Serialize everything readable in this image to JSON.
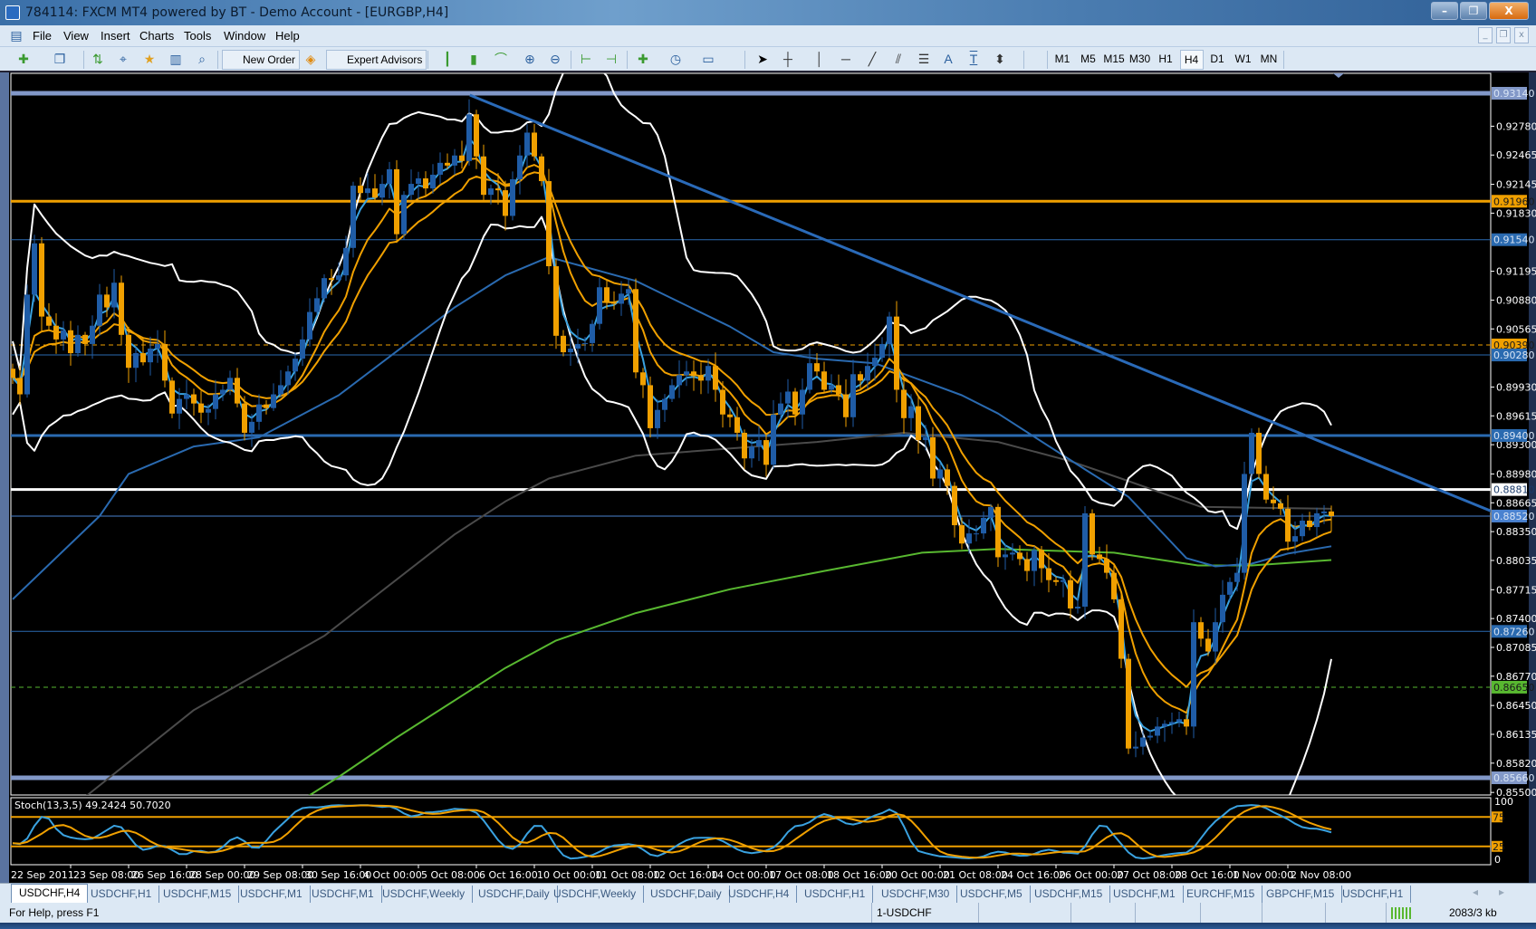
{
  "window": {
    "title": "784114: FXCM MT4 powered by BT - Demo Account - [EURGBP,H4]",
    "min": "–",
    "restore": "❐",
    "close": "X"
  },
  "menu": [
    "File",
    "View",
    "Insert",
    "Charts",
    "Tools",
    "Window",
    "Help"
  ],
  "mdi": {
    "min": "_",
    "restore": "❐",
    "close": "x"
  },
  "toolbar": {
    "new_order": "New Order",
    "expert_advisors": "Expert Advisors",
    "timeframes": [
      "M1",
      "M5",
      "M15",
      "M30",
      "H1",
      "H4",
      "D1",
      "W1",
      "MN"
    ],
    "selected_timeframe": "H4",
    "text_tool": "A",
    "label_tool": "T"
  },
  "colors": {
    "bull": "#1f5ca6",
    "bear": "#f0a000",
    "ema_fast": "#3aa2e0",
    "ema_mid": "#f0a000",
    "bands": "#ffffff",
    "ma_blue": "#2a6ab0",
    "ma_grey": "#4a4a4a",
    "ma_green": "#58b830",
    "trend": "#2a6ab8"
  },
  "chart_data": {
    "type": "candlestick",
    "symbol": "USDCHF",
    "timeframe": "H4",
    "ylim": [
      0.855,
      0.9314
    ],
    "closes": [
      0.9003,
      0.8985,
      0.9094,
      0.915,
      0.907,
      0.906,
      0.9045,
      0.9055,
      0.903,
      0.905,
      0.904,
      0.906,
      0.9094,
      0.908,
      0.9107,
      0.905,
      0.9014,
      0.903,
      0.902,
      0.9035,
      0.904,
      0.9,
      0.8964,
      0.898,
      0.8985,
      0.8975,
      0.8965,
      0.8969,
      0.8985,
      0.899,
      0.9003,
      0.8975,
      0.8943,
      0.8955,
      0.8974,
      0.897,
      0.8985,
      0.8995,
      0.901,
      0.9024,
      0.9045,
      0.9075,
      0.909,
      0.9112,
      0.911,
      0.9115,
      0.9145,
      0.9213,
      0.9205,
      0.921,
      0.92,
      0.9215,
      0.9231,
      0.916,
      0.9203,
      0.9215,
      0.9221,
      0.921,
      0.9225,
      0.9238,
      0.9235,
      0.9246,
      0.924,
      0.9291,
      0.9245,
      0.9203,
      0.921,
      0.9208,
      0.918,
      0.922,
      0.9246,
      0.9271,
      0.9245,
      0.9218,
      0.9125,
      0.9049,
      0.9031,
      0.9035,
      0.904,
      0.9041,
      0.9062,
      0.9102,
      0.9085,
      0.9084,
      0.9095,
      0.91,
      0.9009,
      0.8995,
      0.8948,
      0.8968,
      0.898,
      0.8995,
      0.9006,
      0.901,
      0.9005,
      0.9,
      0.9016,
      0.899,
      0.8963,
      0.896,
      0.8943,
      0.8915,
      0.8928,
      0.8935,
      0.8908,
      0.8963,
      0.8975,
      0.8988,
      0.8963,
      0.899,
      0.9019,
      0.901,
      0.899,
      0.8995,
      0.8985,
      0.896,
      0.9007,
      0.9,
      0.9016,
      0.9025,
      0.904,
      0.907,
      0.899,
      0.8959,
      0.8972,
      0.8935,
      0.8938,
      0.8893,
      0.8903,
      0.8885,
      0.8842,
      0.8822,
      0.8833,
      0.8833,
      0.885,
      0.8862,
      0.8807,
      0.881,
      0.8812,
      0.8805,
      0.8792,
      0.8815,
      0.8795,
      0.8782,
      0.878,
      0.8782,
      0.8751,
      0.8753,
      0.8855,
      0.881,
      0.8805,
      0.879,
      0.8761,
      0.8696,
      0.8598,
      0.86,
      0.861,
      0.8612,
      0.8622,
      0.8625,
      0.8627,
      0.863,
      0.8622,
      0.8736,
      0.8718,
      0.8704,
      0.8736,
      0.8766,
      0.878,
      0.879,
      0.8898,
      0.8943,
      0.8898,
      0.887,
      0.8866,
      0.886,
      0.8824,
      0.883,
      0.8847,
      0.884,
      0.8855,
      0.8857,
      0.8852
    ],
    "ma_blue": [
      [
        0,
        0.8761
      ],
      [
        12,
        0.8852
      ],
      [
        16,
        0.8898
      ],
      [
        25,
        0.8928
      ],
      [
        34,
        0.8938
      ],
      [
        45,
        0.8984
      ],
      [
        61,
        0.908
      ],
      [
        68,
        0.9115
      ],
      [
        74,
        0.9135
      ],
      [
        86,
        0.9109
      ],
      [
        99,
        0.9059
      ],
      [
        105,
        0.9031
      ],
      [
        111,
        0.9024
      ],
      [
        119,
        0.9019
      ],
      [
        131,
        0.8984
      ],
      [
        136,
        0.8964
      ],
      [
        148,
        0.8903
      ],
      [
        154,
        0.8873
      ],
      [
        162,
        0.8806
      ],
      [
        166,
        0.8797
      ],
      [
        171,
        0.88
      ],
      [
        176,
        0.8811
      ],
      [
        182,
        0.8819
      ]
    ],
    "ma_grey": [
      [
        10,
        0.8545
      ],
      [
        25,
        0.864
      ],
      [
        43,
        0.8721
      ],
      [
        61,
        0.8832
      ],
      [
        68,
        0.8868
      ],
      [
        74,
        0.8893
      ],
      [
        86,
        0.8918
      ],
      [
        111,
        0.8933
      ],
      [
        123,
        0.8943
      ],
      [
        136,
        0.8933
      ],
      [
        146,
        0.8912
      ],
      [
        153,
        0.8893
      ],
      [
        164,
        0.8862
      ],
      [
        182,
        0.886
      ]
    ],
    "ma_green": [
      [
        40.6,
        0.8545
      ],
      [
        45,
        0.8567
      ],
      [
        53,
        0.861
      ],
      [
        68,
        0.8686
      ],
      [
        75,
        0.8716
      ],
      [
        86,
        0.8746
      ],
      [
        99,
        0.8772
      ],
      [
        112,
        0.8792
      ],
      [
        125.5,
        0.8812
      ],
      [
        136,
        0.8816
      ],
      [
        152,
        0.8812
      ],
      [
        163.6,
        0.8798
      ],
      [
        171,
        0.8798
      ],
      [
        182,
        0.8804
      ]
    ],
    "trendline": [
      [
        63.1,
        0.9312
      ],
      [
        204.5,
        0.8856
      ]
    ],
    "hlines": [
      {
        "price": 0.9314,
        "label": "0.93140",
        "color": "#8298c8",
        "style": "thick"
      },
      {
        "price": 0.9196,
        "label": "0.91960",
        "color": "#f0a000",
        "style": "medium"
      },
      {
        "price": 0.9154,
        "label": "0.91540",
        "color": "#2a6ab0",
        "style": "thin"
      },
      {
        "price": 0.9039,
        "label": "0.90390",
        "color": "#f0a000",
        "style": "dash"
      },
      {
        "price": 0.9028,
        "label": "0.90280",
        "color": "#2a6ab0",
        "style": "thin"
      },
      {
        "price": 0.894,
        "label": "0.89400",
        "color": "#2a6ab0",
        "style": "medium"
      },
      {
        "price": 0.8881,
        "label": "0.88810",
        "color": "#ffffff",
        "style": "medium"
      },
      {
        "price": 0.8852,
        "label": "0.88520",
        "color": "#4a82d0",
        "style": "thin"
      },
      {
        "price": 0.8726,
        "label": "0.87260",
        "color": "#2a6ab0",
        "style": "thin"
      },
      {
        "price": 0.8665,
        "label": "0.86650",
        "color": "#58b830",
        "style": "dash"
      },
      {
        "price": 0.8566,
        "label": "0.85660",
        "color": "#8298c8",
        "style": "thick"
      }
    ],
    "yticks": [
      "0.92780",
      "0.92465",
      "0.92145",
      "0.91830",
      "0.91195",
      "0.90880",
      "0.90565",
      "0.89930",
      "0.89615",
      "0.89300",
      "0.88980",
      "0.88665",
      "0.88350",
      "0.88035",
      "0.87715",
      "0.87400",
      "0.87085",
      "0.86770",
      "0.86450",
      "0.86135",
      "0.85820",
      "0.85500"
    ],
    "xticks": [
      "22 Sep 2011",
      "23 Sep 08:00",
      "26 Sep 16:00",
      "28 Sep 00:00",
      "29 Sep 08:00",
      "30 Sep 16:00",
      "4 Oct 00:00",
      "5 Oct 08:00",
      "6 Oct 16:00",
      "10 Oct 00:00",
      "11 Oct 08:00",
      "12 Oct 16:00",
      "14 Oct 00:00",
      "17 Oct 08:00",
      "18 Oct 16:00",
      "20 Oct 00:00",
      "21 Oct 08:00",
      "24 Oct 16:00",
      "26 Oct 00:00",
      "27 Oct 08:00",
      "28 Oct 16:00",
      "1 Nov 00:00",
      "2 Nov 08:00"
    ],
    "xtick_every_bars": 8,
    "stoch": {
      "label": "Stoch(13,3,5) 49.2424 50.7020",
      "k": 13,
      "slow": 3,
      "d": 5,
      "levels": [
        75,
        25
      ],
      "level_labels": [
        "75",
        "25"
      ],
      "scale": [
        "100",
        "0"
      ]
    }
  },
  "tabs": [
    "USDCHF,H4",
    "USDCHF,H1",
    "USDCHF,M15",
    "USDCHF,M1",
    "USDCHF,M1",
    "USDCHF,Weekly",
    "USDCHF,Daily",
    "USDCHF,Weekly",
    "USDCHF,Daily",
    "USDCHF,H4",
    "USDCHF,H1",
    "USDCHF,M30",
    "USDCHF,M5",
    "USDCHF,M15",
    "USDCHF,M1",
    "EURCHF,M15",
    "GBPCHF,M15",
    "USDCHF,H1"
  ],
  "tab_scroll": {
    "left": "◂",
    "right": "▸"
  },
  "status": {
    "help": "For Help, press F1",
    "profile": "1-USDCHF",
    "traffic": "2083/3 kb"
  }
}
